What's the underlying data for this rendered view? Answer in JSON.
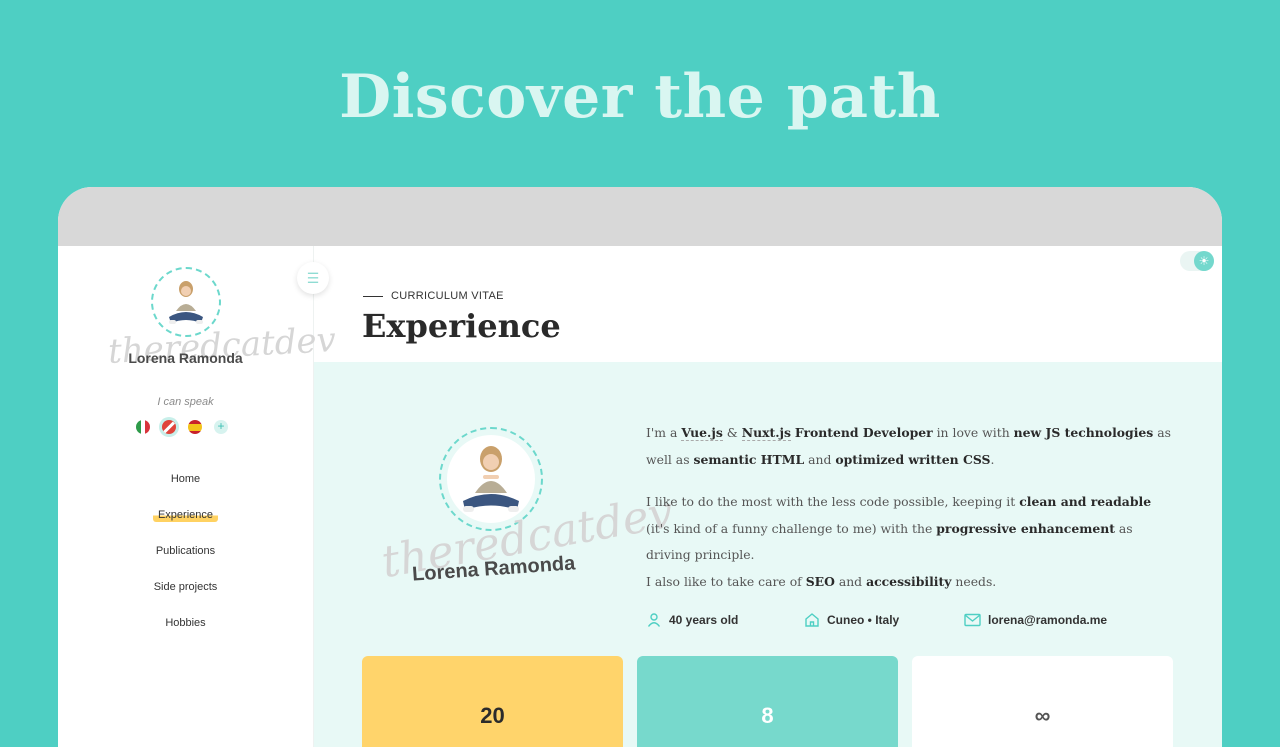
{
  "hero": {
    "title": "Discover the path"
  },
  "sidebar": {
    "name": "Lorena Ramonda",
    "signature": "theredcatdev",
    "speak_label": "I can speak",
    "languages": [
      {
        "name": "italian-flag"
      },
      {
        "name": "piedmontese-flag"
      },
      {
        "name": "spanish-flag"
      }
    ],
    "add_language": "+",
    "nav": [
      {
        "label": "Home"
      },
      {
        "label": "Experience",
        "active": true
      },
      {
        "label": "Publications"
      },
      {
        "label": "Side projects"
      },
      {
        "label": "Hobbies"
      }
    ]
  },
  "header": {
    "kicker": "CURRICULUM VITAE",
    "title": "Experience"
  },
  "profile": {
    "name": "Lorena Ramonda",
    "signature": "theredcatdev",
    "facts": {
      "age": "40 years old",
      "location": "Cuneo • Italy",
      "email": "lorena@ramonda.me"
    }
  },
  "stats": [
    "20",
    "8",
    "∞"
  ],
  "colors": {
    "background": "#4ecfc3",
    "accent": "#6cd8cc",
    "highlight": "#ffd262",
    "card_yellow": "#ffd46b",
    "card_teal": "#77d9cc"
  }
}
